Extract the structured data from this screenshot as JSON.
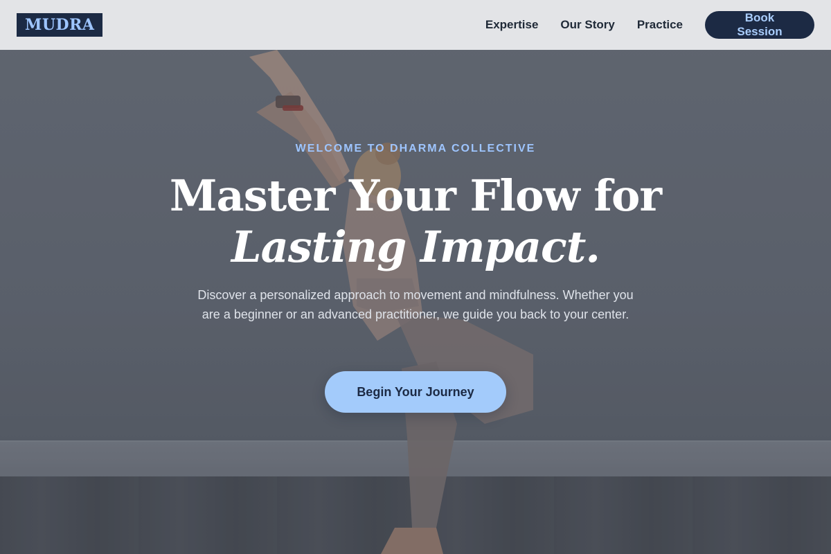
{
  "header": {
    "logo": "MUDRA",
    "nav": [
      "Expertise",
      "Our Story",
      "Practice"
    ],
    "cta": "Book Session"
  },
  "hero": {
    "eyebrow": "WELCOME TO DHARMA COLLECTIVE",
    "headline_line1": "Master Your Flow for",
    "headline_line2": "Lasting Impact.",
    "description": "Discover a personalized approach to movement and mindfulness. Whether you are a beginner or an advanced practitioner, we guide you back to your center.",
    "button": "Begin Your Journey",
    "background_image": "yoga-practitioner-photo"
  },
  "colors": {
    "brand_navy": "#1c2a44",
    "accent_blue": "#9ec5ff",
    "header_bg": "#e3e4e7"
  }
}
